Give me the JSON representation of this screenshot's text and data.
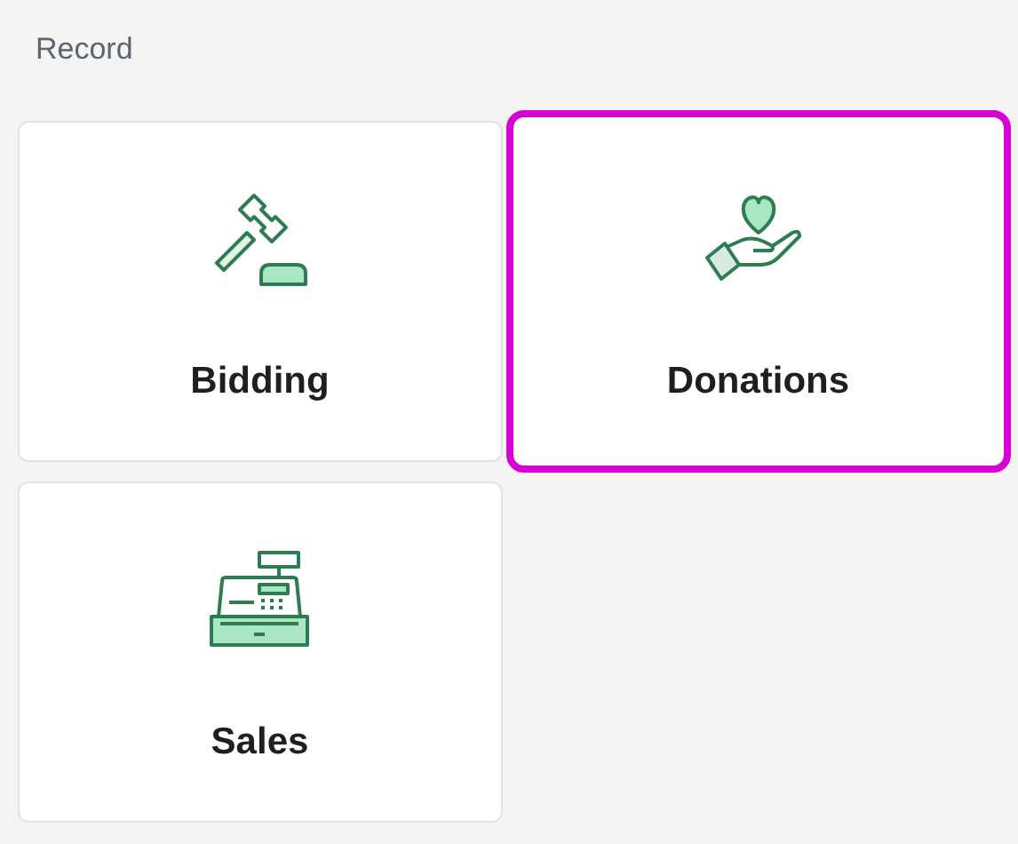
{
  "heading": "Record",
  "cards": [
    {
      "kind": "gavel",
      "label": "Bidding",
      "selected": false
    },
    {
      "kind": "donation",
      "label": "Donations",
      "selected": true
    },
    {
      "kind": "register",
      "label": "Sales",
      "selected": false
    }
  ]
}
